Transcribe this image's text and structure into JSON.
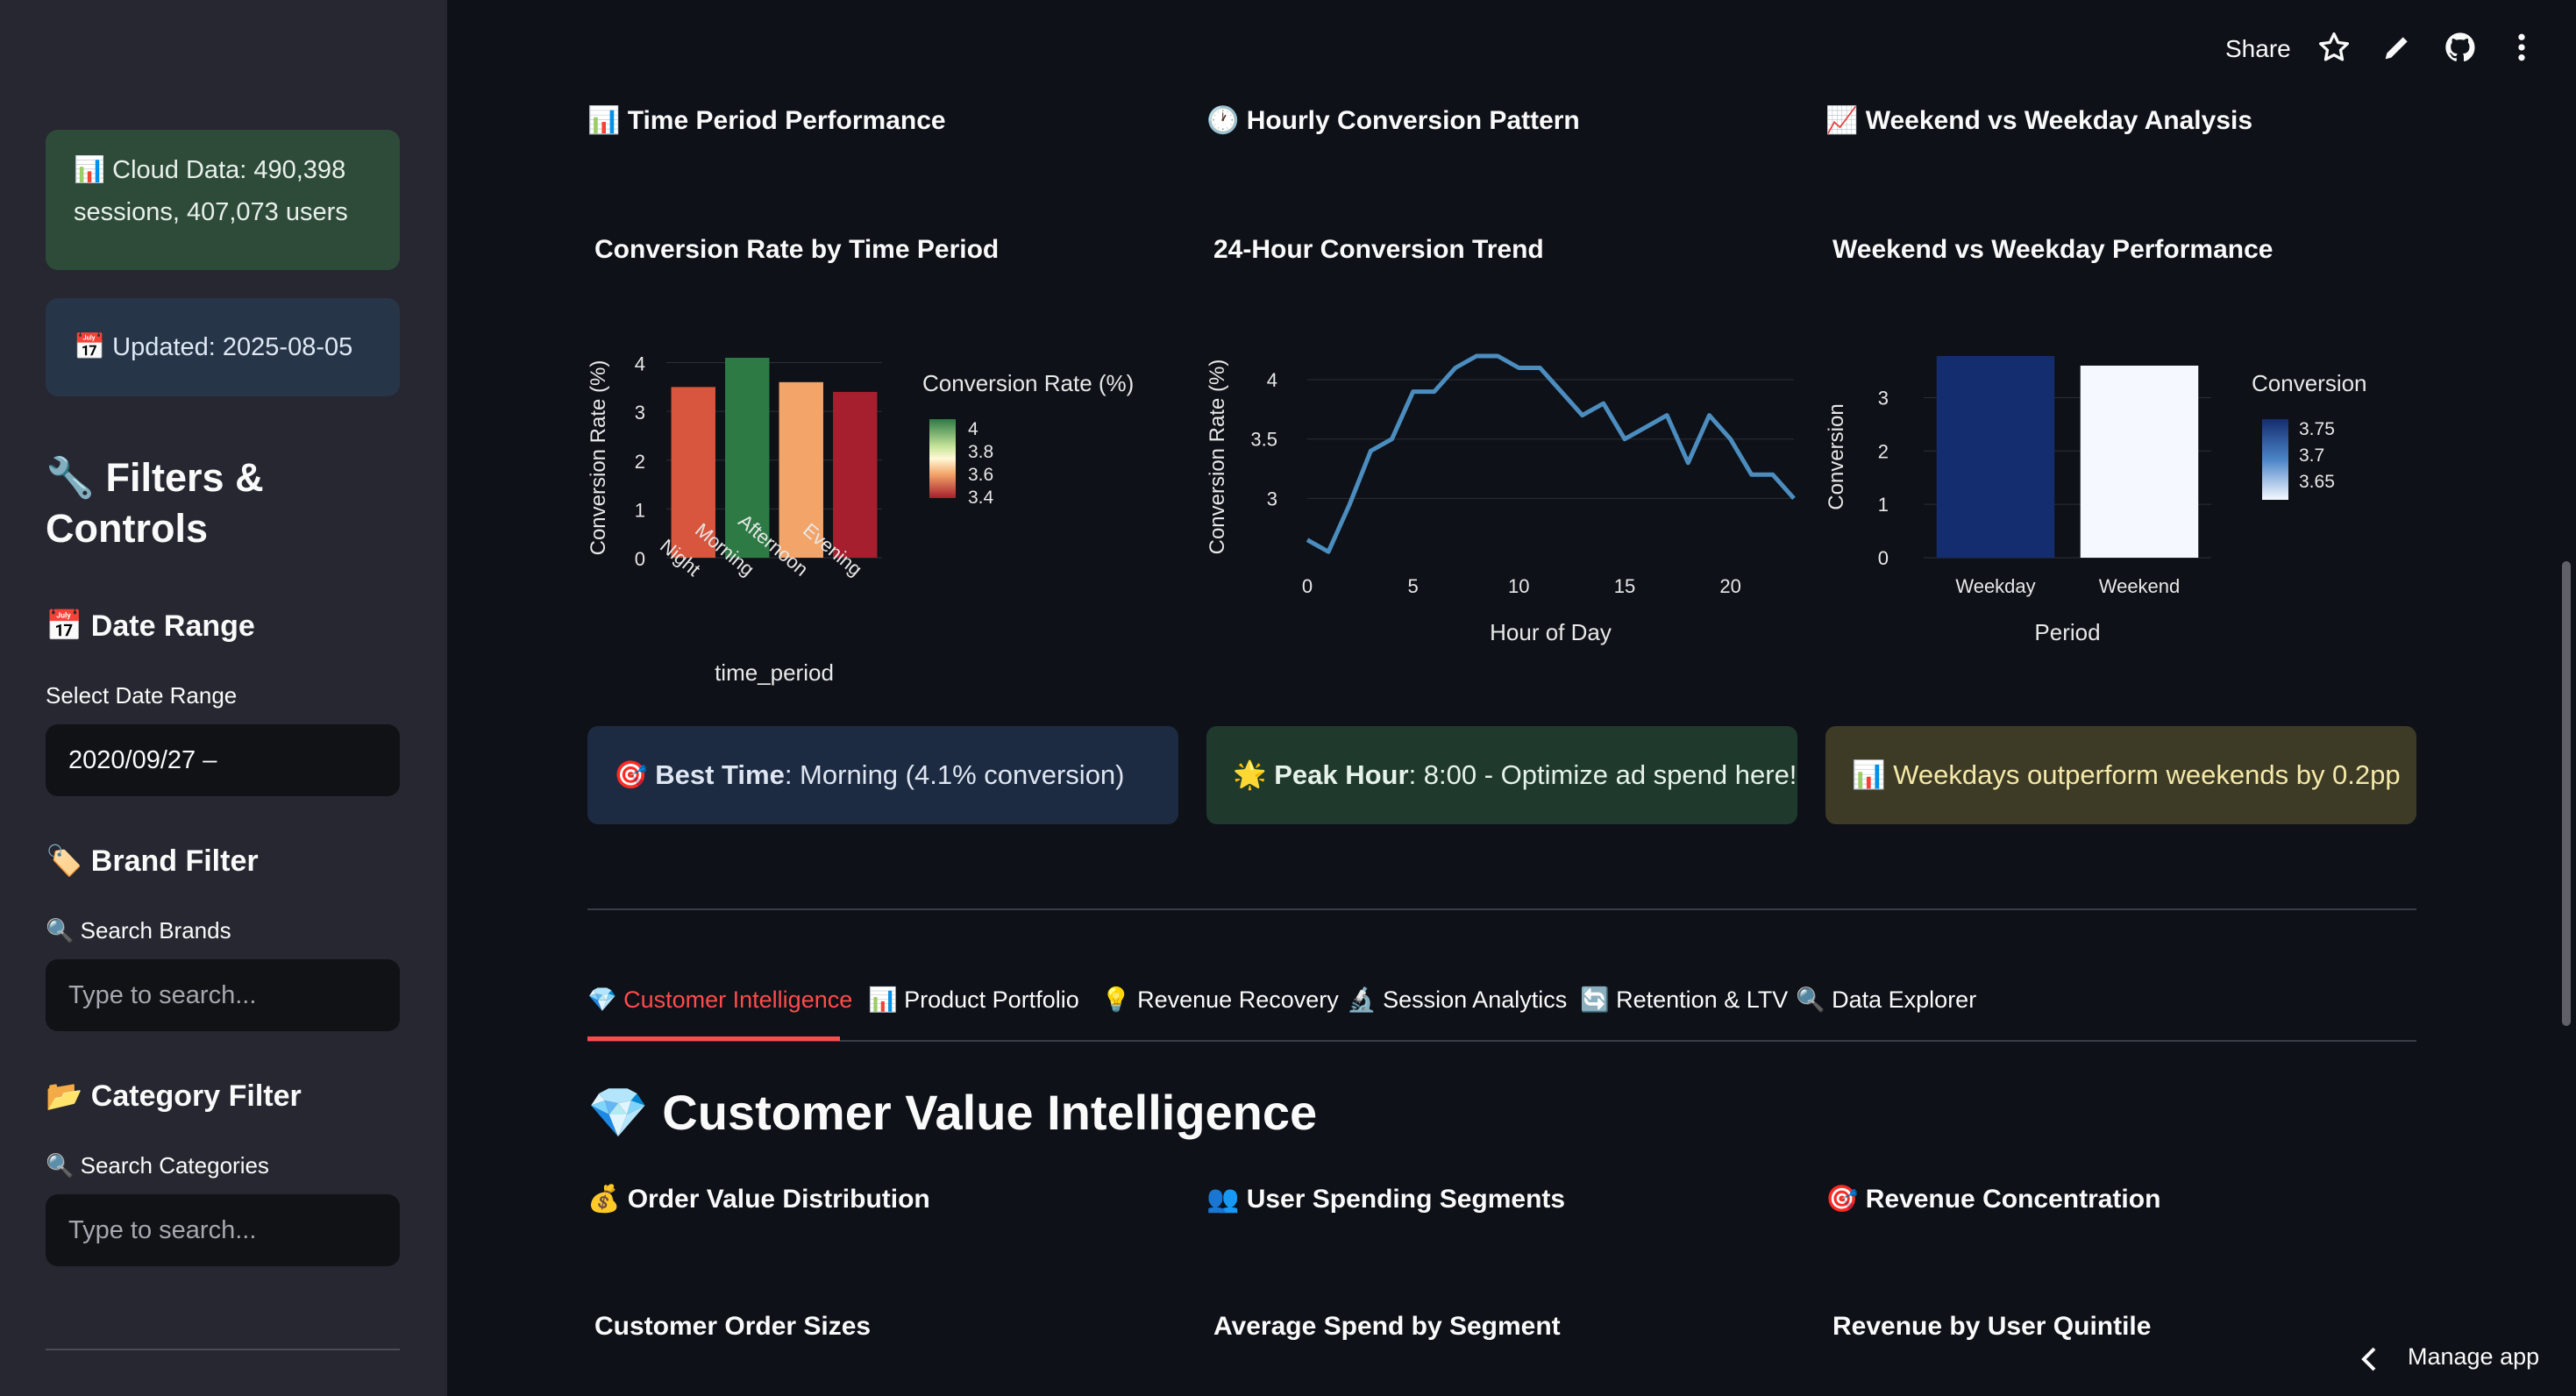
{
  "sidebar": {
    "cloud_info": "📊 Cloud Data: 490,398 sessions, 407,073 users",
    "updated": "📅 Updated: 2025-08-05",
    "filters_title": "🔧 Filters & Controls",
    "date_range": {
      "title": "📅 Date Range",
      "label": "Select Date Range",
      "value": "2020/09/27 –"
    },
    "brand_filter": {
      "title": "🏷️ Brand Filter",
      "label": "🔍 Search Brands",
      "placeholder": "Type to search..."
    },
    "category_filter": {
      "title": "📂 Category Filter",
      "label": "🔍 Search Categories",
      "placeholder": "Type to search..."
    }
  },
  "header": {
    "share_label": "Share",
    "icons": [
      "star-icon",
      "pencil-icon",
      "github-icon",
      "more-vertical-icon"
    ]
  },
  "sections": {
    "time_period": "📊 Time Period Performance",
    "hourly": "🕐 Hourly Conversion Pattern",
    "weekend": "📈 Weekend vs Weekday Analysis"
  },
  "chart_data": [
    {
      "type": "bar",
      "title": "Conversion Rate by Time Period",
      "categories": [
        "Night",
        "Morning",
        "Afternoon",
        "Evening"
      ],
      "values": [
        3.5,
        4.1,
        3.6,
        3.4
      ],
      "colors": [
        "#d7563d",
        "#2e7a45",
        "#f3a468",
        "#a51f2e"
      ],
      "xlabel": "time_period",
      "ylabel": "Conversion Rate (%)",
      "ylim": [
        0,
        4.1
      ],
      "yticks": [
        0,
        1,
        2,
        3,
        4
      ],
      "legend": {
        "title": "Conversion Rate (%)",
        "ticks": [
          "4",
          "3.8",
          "3.6",
          "3.4"
        ]
      }
    },
    {
      "type": "line",
      "title": "24-Hour Conversion Trend",
      "x": [
        0,
        1,
        2,
        3,
        4,
        5,
        6,
        7,
        8,
        9,
        10,
        11,
        12,
        13,
        14,
        15,
        16,
        17,
        18,
        19,
        20,
        21,
        22,
        23
      ],
      "values": [
        2.65,
        2.55,
        2.95,
        3.4,
        3.5,
        3.9,
        3.9,
        4.1,
        4.2,
        4.2,
        4.1,
        4.1,
        3.9,
        3.7,
        3.8,
        3.5,
        3.6,
        3.7,
        3.3,
        3.7,
        3.5,
        3.2,
        3.2,
        3.0
      ],
      "color": "#4c8dc0",
      "xlabel": "Hour of Day",
      "ylabel": "Conversion Rate (%)",
      "xlim": [
        0,
        23
      ],
      "ylim": [
        2.5,
        4.2
      ],
      "xticks": [
        0,
        5,
        10,
        15,
        20
      ],
      "yticks": [
        3,
        3.5,
        4
      ]
    },
    {
      "type": "bar",
      "title": "Weekend vs Weekday Performance",
      "categories": [
        "Weekday",
        "Weekend"
      ],
      "values": [
        3.78,
        3.6
      ],
      "colors": [
        "#142d6e",
        "#f5f9ff"
      ],
      "xlabel": "Period",
      "ylabel": "Conversion",
      "ylim": [
        0,
        3.78
      ],
      "yticks": [
        0,
        1,
        2,
        3
      ],
      "legend": {
        "title": "Conversion",
        "ticks": [
          "3.75",
          "3.7",
          "3.65"
        ]
      }
    }
  ],
  "insights": {
    "best_time": {
      "prefix": "🎯 ",
      "bold": "Best Time",
      "rest": ": Morning (4.1% conversion)"
    },
    "peak_hour": {
      "prefix": "🌟 ",
      "bold": "Peak Hour",
      "rest": ": 8:00 - Optimize ad spend here!"
    },
    "weekdays": "📊 Weekdays outperform weekends by 0.2pp"
  },
  "tabs": [
    {
      "label": "💎 Customer Intelligence",
      "active": true
    },
    {
      "label": "📊 Product Portfolio"
    },
    {
      "label": "💡 Revenue Recovery"
    },
    {
      "label": "🔬 Session Analytics"
    },
    {
      "label": "🔄 Retention & LTV"
    },
    {
      "label": "🔍 Data Explorer"
    }
  ],
  "customer": {
    "title": "💎 Customer Value Intelligence",
    "sections": [
      "💰 Order Value Distribution",
      "👥 User Spending Segments",
      "🎯 Revenue Concentration"
    ],
    "chart_titles": [
      "Customer Order Sizes",
      "Average Spend by Segment",
      "Revenue by User Quintile"
    ]
  },
  "footer": {
    "manage_label": "Manage app"
  }
}
